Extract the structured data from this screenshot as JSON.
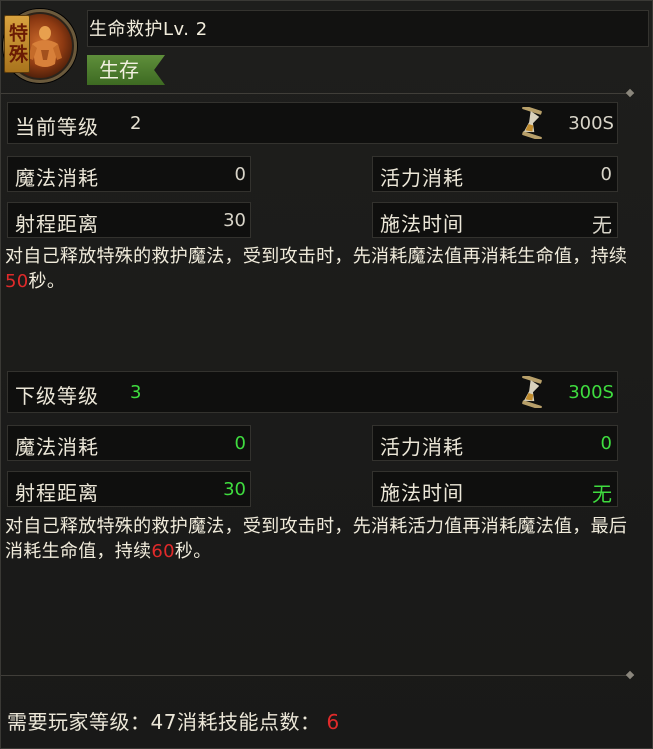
{
  "header": {
    "special_tag": "特殊",
    "skill_name": "生命救护Lv. 2",
    "category": "生存"
  },
  "current": {
    "level_label": "当前等级",
    "level_value": "2",
    "cast_cooldown": "300S",
    "mana_cost_label": "魔法消耗",
    "mana_cost": "0",
    "vigor_cost_label": "活力消耗",
    "vigor_cost": "0",
    "range_label": "射程距离",
    "range": "30",
    "cast_time_label": "施法时间",
    "cast_time": "无",
    "desc_before": "对自己释放特殊的救护魔法，受到攻击时，先消耗魔法值再消耗生命值，持续",
    "desc_duration": "50",
    "desc_after": "秒。"
  },
  "next": {
    "level_label": "下级等级",
    "level_value": "3",
    "cast_cooldown": "300S",
    "mana_cost_label": "魔法消耗",
    "mana_cost": "0",
    "vigor_cost_label": "活力消耗",
    "vigor_cost": "0",
    "range_label": "射程距离",
    "range": "30",
    "cast_time_label": "施法时间",
    "cast_time": "无",
    "desc_before": "对自己释放特殊的救护魔法，受到攻击时，先消耗活力值再消耗魔法值，最后消耗生命值，持续",
    "desc_duration": "60",
    "desc_after": "秒。"
  },
  "footer": {
    "required_level_label": "需要玩家等级：",
    "required_level": "47",
    "skill_points_label": "消耗技能点数：",
    "skill_points": "6"
  },
  "colors": {
    "green_value": "#3fdc3f",
    "red_value": "#e02a2a",
    "category_green": "#4f7d30"
  },
  "icons": [
    "skill-portrait-icon",
    "hourglass-icon"
  ]
}
